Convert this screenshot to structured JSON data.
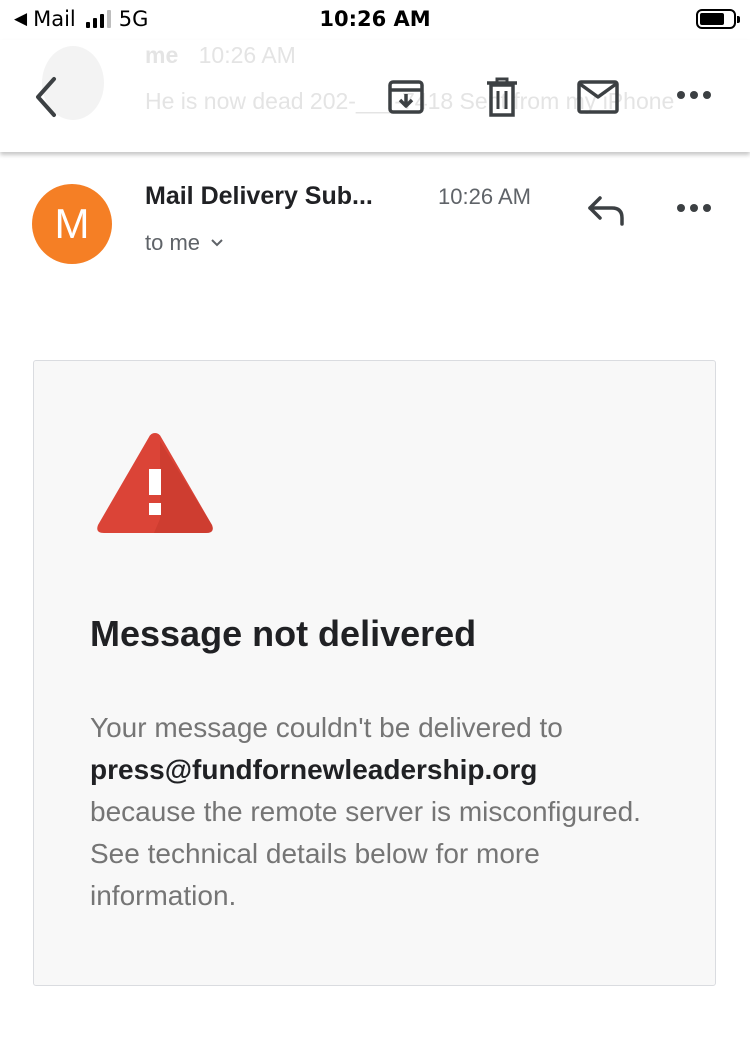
{
  "status_bar": {
    "back_app": "Mail",
    "network": "5G",
    "time": "10:26 AM"
  },
  "thread_preview": {
    "sender": "me",
    "time": "10:26 AM",
    "snippet": "He is now dead 202-___-7418 Sent from my iPhone"
  },
  "toolbar": {
    "icons": [
      "back-chevron-icon",
      "archive-icon",
      "trash-icon",
      "mail-icon",
      "more-icon"
    ]
  },
  "message": {
    "avatar_letter": "M",
    "avatar_color": "#f57f25",
    "sender": "Mail Delivery Sub...",
    "time": "10:26 AM",
    "recipient": "to me"
  },
  "bounce": {
    "title": "Message not delivered",
    "body_before": "Your message couldn't be delivered to",
    "address": "press@fundfornewleadership.org",
    "body_after": "because the remote server is misconfigured. See technical details below for more information.",
    "warning_color": "#db4437"
  }
}
